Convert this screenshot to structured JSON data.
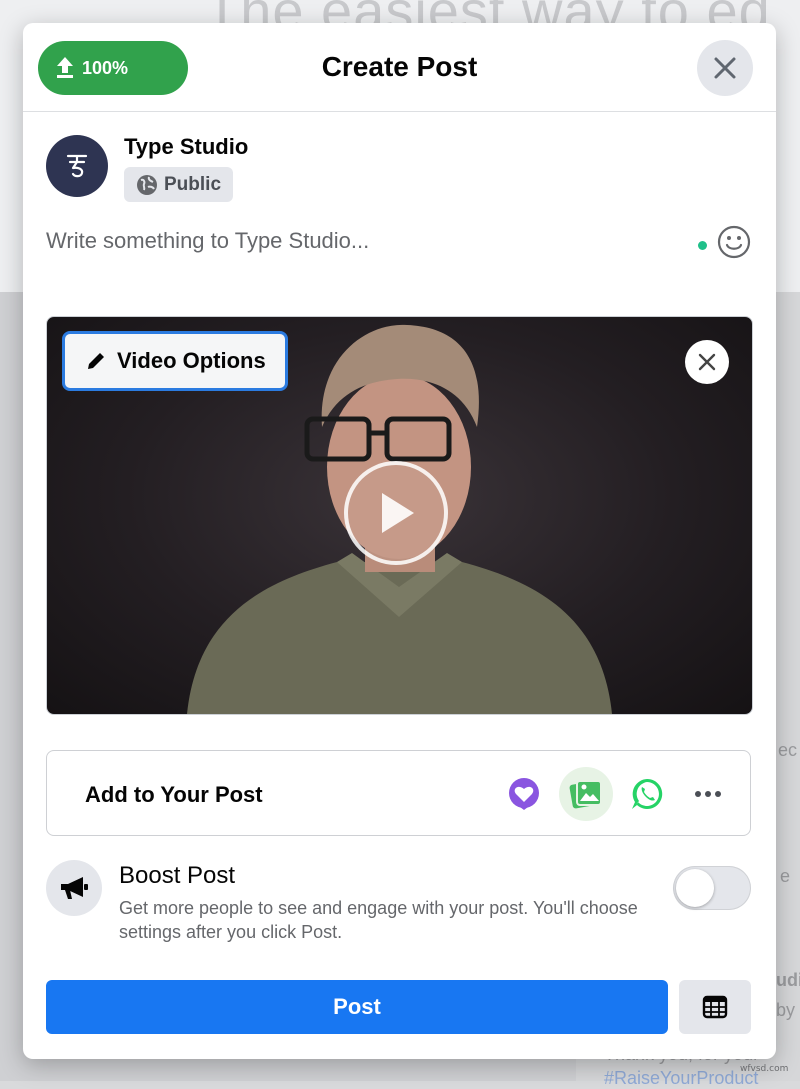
{
  "background": {
    "heading": "The easiest way to ed",
    "right_texts": [
      "ec",
      "e",
      "udio",
      "by (",
      "Thank you, for your"
    ],
    "hashtag": "#RaiseYourProduct"
  },
  "header": {
    "upload_progress": "100%",
    "title": "Create Post"
  },
  "author": {
    "name": "Type Studio",
    "audience": "Public"
  },
  "composer": {
    "placeholder": "Write something to Type Studio..."
  },
  "media": {
    "options_label": "Video Options"
  },
  "add_to_post": {
    "label": "Add to Your Post",
    "icons": [
      "feeling-heart-icon",
      "photo-video-icon",
      "whatsapp-icon",
      "more-icon"
    ]
  },
  "boost": {
    "title": "Boost Post",
    "description": "Get more people to see and engage with your post. You'll choose settings after you click Post.",
    "enabled": false
  },
  "actions": {
    "post_label": "Post"
  },
  "watermark": "wfvsd.com",
  "colors": {
    "primary": "#1877f2",
    "upload_green": "#31a24c",
    "focus_blue": "#2b7be0"
  }
}
